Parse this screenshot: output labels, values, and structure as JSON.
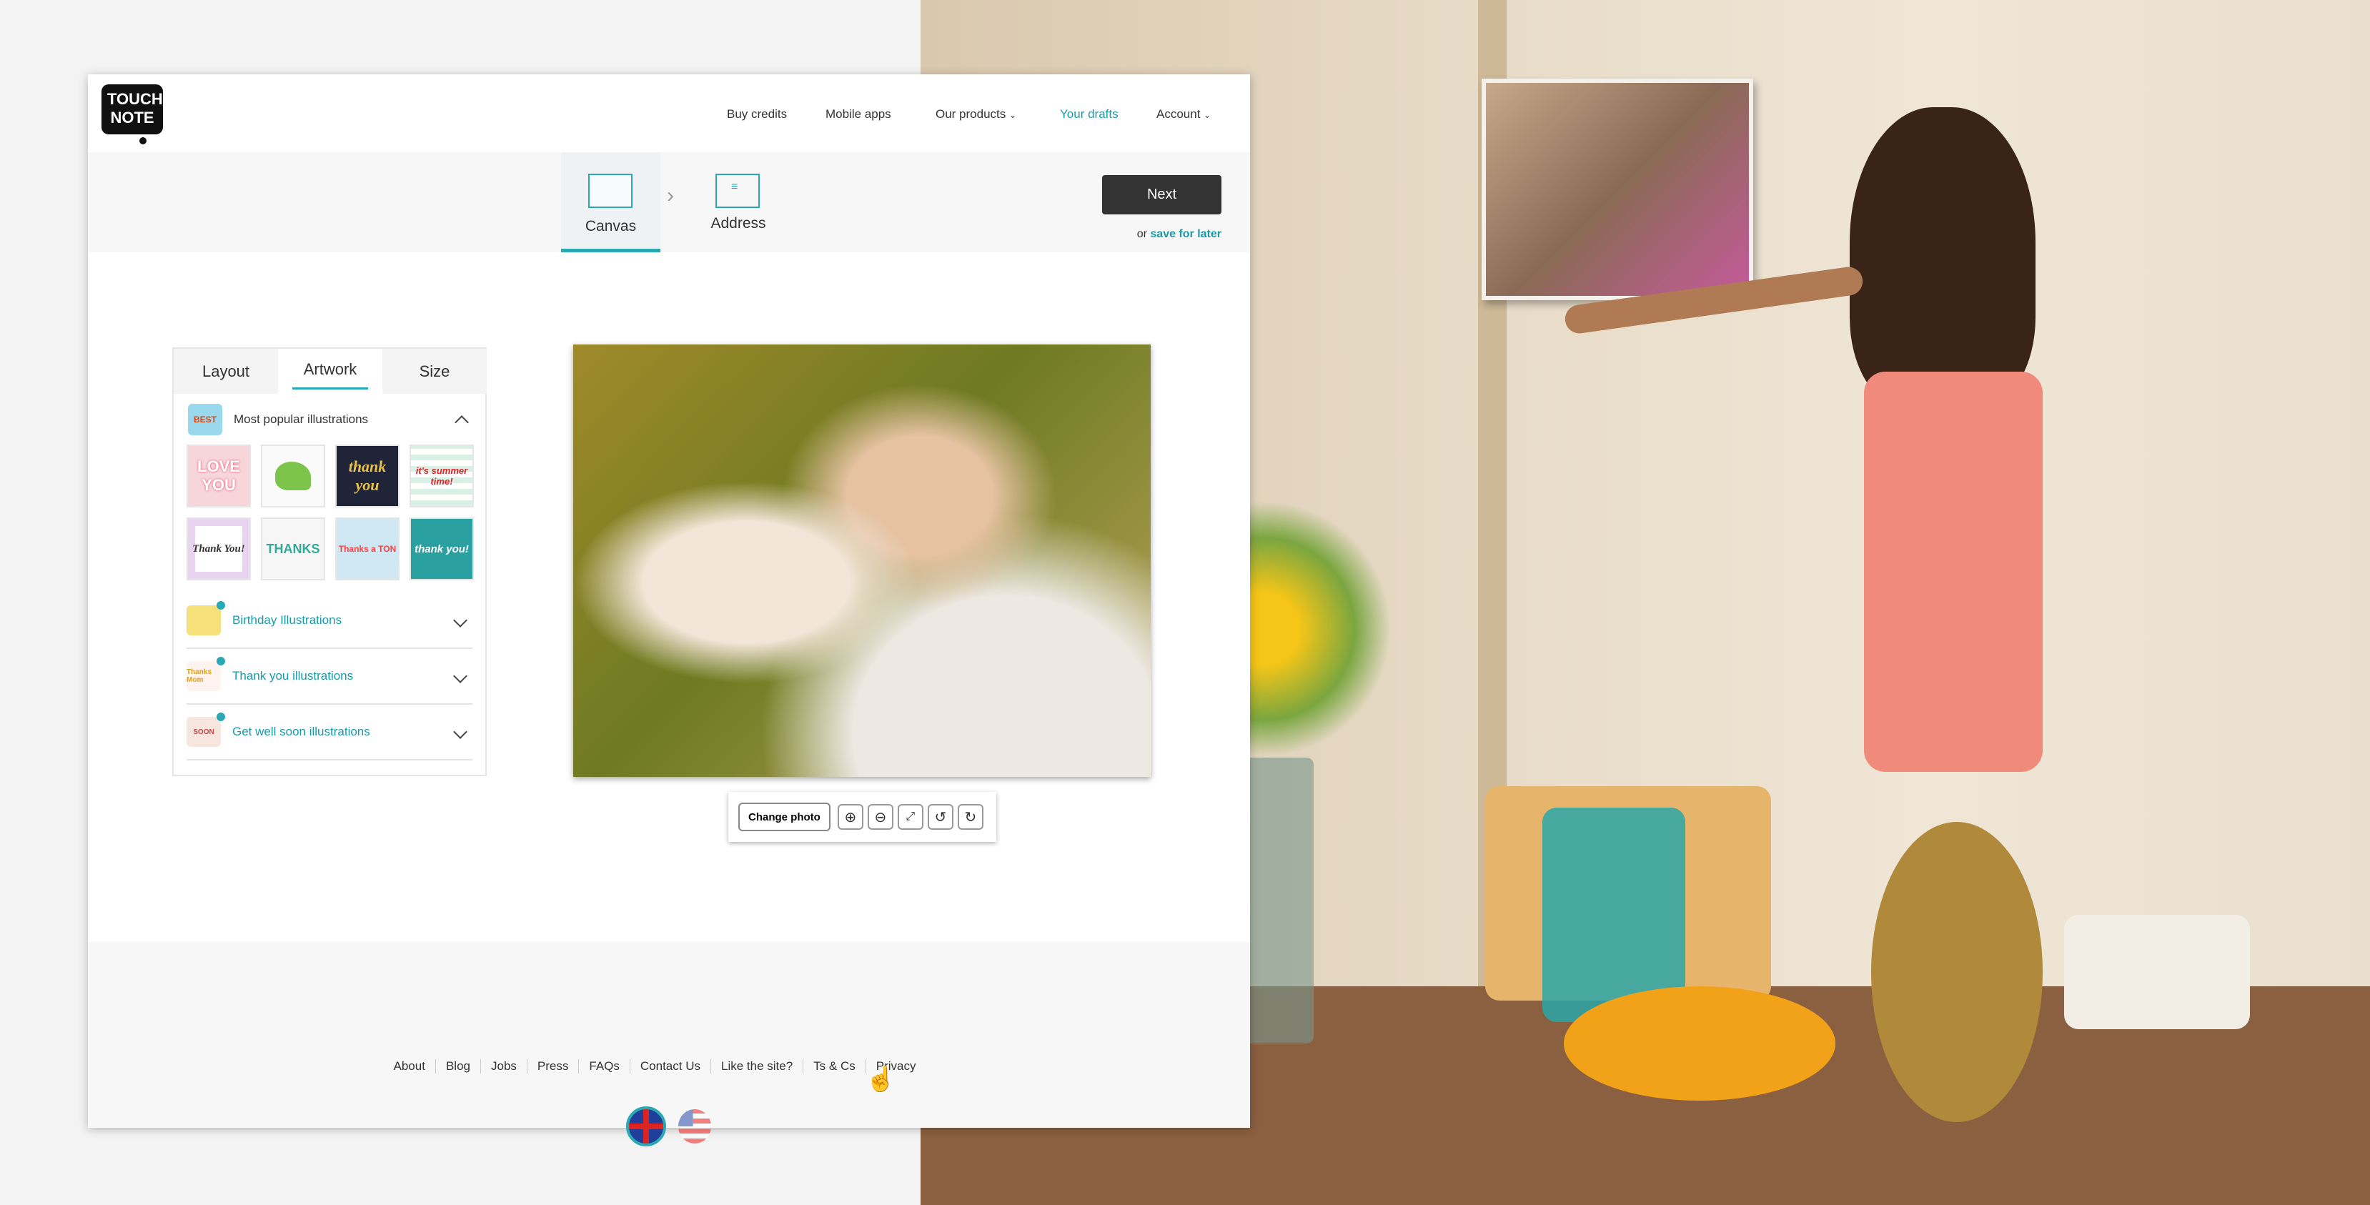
{
  "header": {
    "logo": "TOUCH NOTE",
    "nav": [
      {
        "label": "Buy credits"
      },
      {
        "label": "Mobile apps"
      },
      {
        "label": "Our products",
        "dropdown": true
      },
      {
        "label": "Your drafts",
        "active": true
      },
      {
        "label": "Account",
        "dropdown": true
      }
    ]
  },
  "steps": {
    "items": [
      {
        "label": "Canvas",
        "active": true,
        "icon": "canvas-icon"
      },
      {
        "label": "Address",
        "icon": "postcard-icon"
      }
    ],
    "next_label": "Next",
    "or_text": "or",
    "save_label": "save for later"
  },
  "panel": {
    "tabs": [
      "Layout",
      "Artwork",
      "Size"
    ],
    "active_tab": "Artwork",
    "popular": {
      "title": "Most popular illustrations",
      "badge": "BEST",
      "thumbs": [
        "LOVE YOU",
        "dinosaur",
        "thank you",
        "it's summer time!",
        "Thank You!",
        "THANKS",
        "Thanks a TON",
        "thank you!"
      ]
    },
    "sections": [
      {
        "title": "Birthday Illustrations"
      },
      {
        "title": "Thank you illustrations",
        "thumb": "Thanks Mom"
      },
      {
        "title": "Get well soon illustrations",
        "thumb": "SOON"
      }
    ]
  },
  "toolbar": {
    "change_photo": "Change photo",
    "icons": [
      "zoom-in-icon",
      "zoom-out-icon",
      "fit-icon",
      "rotate-left-icon",
      "rotate-right-icon"
    ]
  },
  "footer": {
    "links": [
      "About",
      "Blog",
      "Jobs",
      "Press",
      "FAQs",
      "Contact Us",
      "Like the site?",
      "Ts & Cs",
      "Privacy"
    ],
    "active_link": "Ts & Cs",
    "flags": [
      "uk-flag",
      "us-flag"
    ]
  },
  "colors": {
    "accent": "#1a9aa6",
    "next_button": "#333333"
  }
}
